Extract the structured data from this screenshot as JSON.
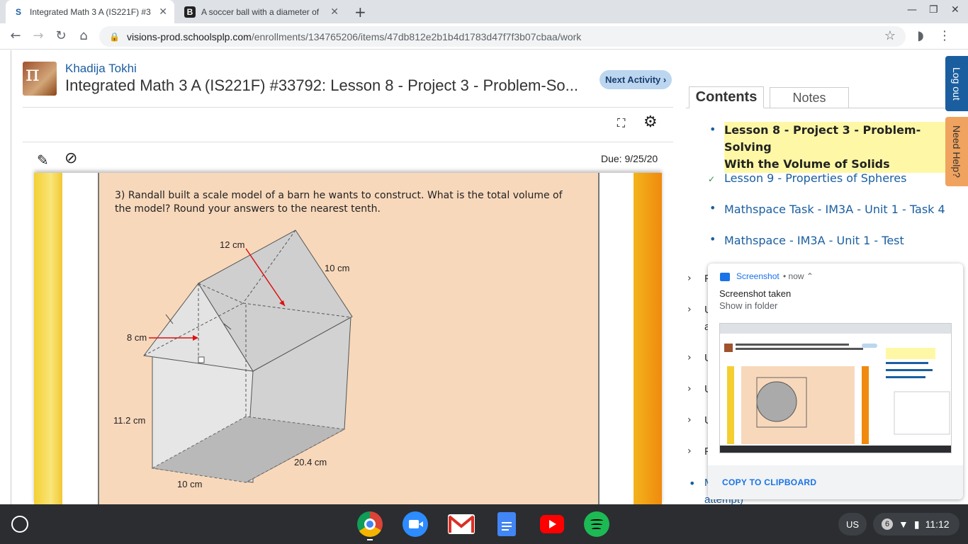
{
  "browser": {
    "tabs": [
      {
        "title": "Integrated Math 3 A (IS221F) #3",
        "favicon": "S"
      },
      {
        "title": "A soccer ball with a diameter of",
        "favicon": "B"
      }
    ],
    "url_host": "visions-prod.schoolsplp.com",
    "url_path": "/enrollments/134765206/items/47db812e2b1b4d1783d47f7f3b07cbaa/work"
  },
  "header": {
    "student_name": "Khadija Tokhi",
    "course_title": "Integrated Math 3 A (IS221F) #33792: Lesson 8 - Project 3 - Problem-So...",
    "next_activity": "Next Activity ›",
    "due": "Due: 9/25/20"
  },
  "worksheet": {
    "question": "3) Randall built a scale model of a barn he wants to construct. What is the total volume of the model? Round your answers to the nearest tenth.",
    "labels": {
      "top": "12 cm",
      "slant": "10 cm",
      "height_tri": "8 cm",
      "height_box": "11.2 cm",
      "depth": "20.4 cm",
      "width": "10 cm"
    }
  },
  "sidebar": {
    "tab_contents": "Contents",
    "tab_notes": "Notes",
    "lessons": [
      {
        "label": "Lesson 8 - Project 3 - Problem-Solving With the Volume of Solids",
        "line1": "Lesson 8 - Project 3 - Problem-Solving",
        "line2": "With the Volume of Solids",
        "state": "current"
      },
      {
        "label": "Lesson 9 - Properties of Spheres",
        "state": "done"
      },
      {
        "label": "Mathspace Task - IM3A - Unit 1 - Task 4",
        "state": "todo"
      },
      {
        "label": "Mathspace - IM3A - Unit 1 - Test",
        "state": "todo"
      }
    ],
    "collapsed_letters": [
      "F",
      "U",
      "a",
      "U",
      "U",
      "U",
      "F",
      "M"
    ],
    "trailing_text": "attempt)",
    "logout": "Log out",
    "need_help": "Need Help?"
  },
  "notification": {
    "app": "Screenshot",
    "time": "• now ⌃",
    "title": "Screenshot taken",
    "subtitle": "Show in folder",
    "action": "COPY TO CLIPBOARD"
  },
  "shelf": {
    "lang": "US",
    "notif_count": "6",
    "time": "11:12"
  },
  "colors": {
    "accent": "#1a5ea0",
    "worksheet_bg": "#f8d8bb",
    "highlight": "#fef8a6"
  }
}
